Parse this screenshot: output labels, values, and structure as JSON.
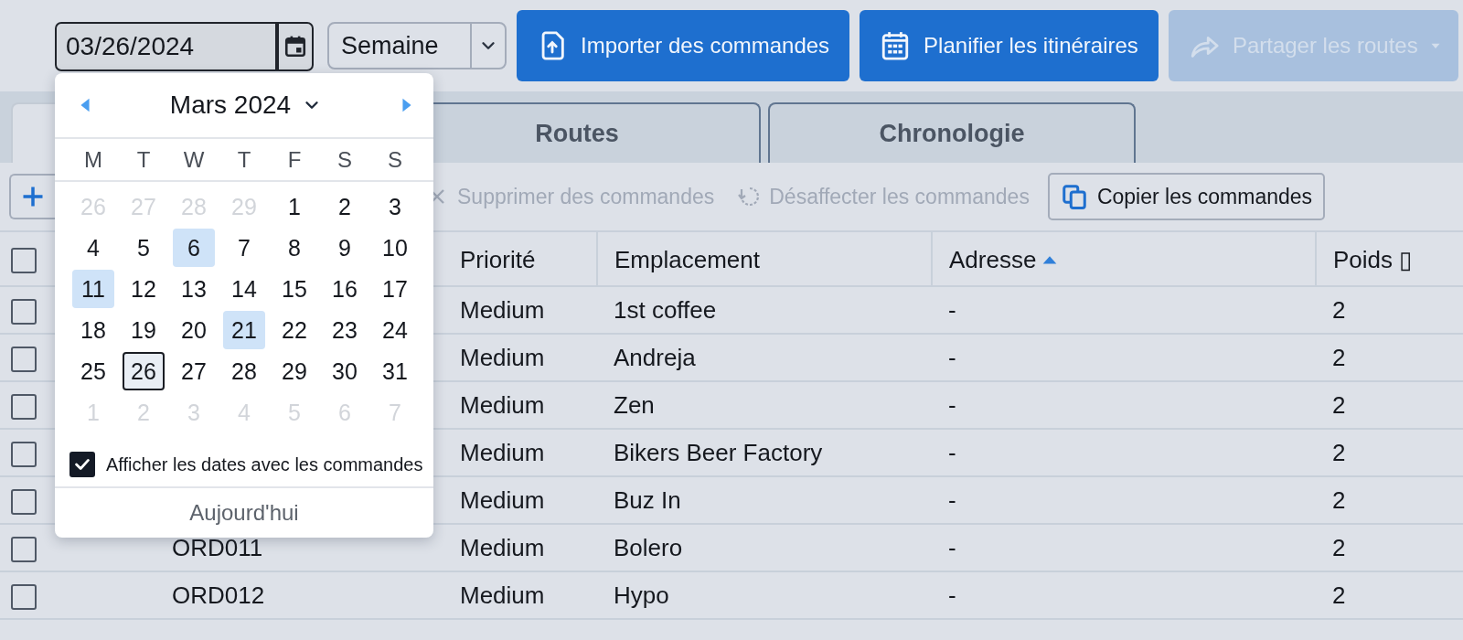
{
  "toolbar": {
    "date_field": {
      "value": "03/26/2024"
    },
    "period_select": {
      "value": "Semaine"
    },
    "buttons": [
      {
        "label": "Importer des commandes",
        "kind": "import",
        "disabled": false,
        "dropdown": false
      },
      {
        "label": "Planifier les itinéraires",
        "kind": "plan",
        "disabled": false,
        "dropdown": false
      },
      {
        "label": "Partager les routes",
        "kind": "share",
        "disabled": true,
        "dropdown": true
      }
    ]
  },
  "tabs": [
    {
      "selected": true
    },
    {
      "label": "Routes",
      "selected": false
    },
    {
      "label": "Chronologie",
      "selected": false
    }
  ],
  "actions": [
    {
      "kind": "add"
    },
    {
      "label": "Supprimer des commandes",
      "kind": "delete",
      "disabled": true
    },
    {
      "label": "Désaffecter les commandes",
      "kind": "unassign",
      "disabled": true
    },
    {
      "label": "Copier les commandes",
      "kind": "copy",
      "disabled": false
    }
  ],
  "table": {
    "header_checked": false,
    "columns": [
      {
        "label": "Priorité",
        "sorted": false
      },
      {
        "label": "Emplacement",
        "sorted": false
      },
      {
        "label": "Adresse",
        "sorted": true
      },
      {
        "label": "Poids ▯",
        "sorted": false
      }
    ],
    "rows": [
      {
        "checked": false,
        "priority": "Medium",
        "location": "1st coffee",
        "address": "-",
        "weight": "2"
      },
      {
        "checked": false,
        "priority": "Medium",
        "location": "Andreja",
        "address": "-",
        "weight": "2"
      },
      {
        "checked": false,
        "priority": "Medium",
        "location": "Zen",
        "address": "-",
        "weight": "2"
      },
      {
        "checked": false,
        "priority": "Medium",
        "location": "Bikers Beer Factory",
        "address": "-",
        "weight": "2"
      },
      {
        "checked": false,
        "priority": "Medium",
        "location": "Buz In",
        "address": "-",
        "weight": "2"
      },
      {
        "checked": false,
        "order": "ORD011",
        "priority": "Medium",
        "location": "Bolero",
        "address": "-",
        "weight": "2"
      },
      {
        "checked": false,
        "order": "ORD012",
        "priority": "Medium",
        "location": "Hypo",
        "address": "-",
        "weight": "2"
      }
    ]
  },
  "calendar": {
    "month": "Mars 2024",
    "weekdays": [
      "M",
      "T",
      "W",
      "T",
      "F",
      "S",
      "S"
    ],
    "weeks": [
      [
        {
          "day": "26",
          "outside": true,
          "marked": false,
          "selected": false
        },
        {
          "day": "27",
          "outside": true,
          "marked": false,
          "selected": false
        },
        {
          "day": "28",
          "outside": true,
          "marked": false,
          "selected": false
        },
        {
          "day": "29",
          "outside": true,
          "marked": false,
          "selected": false
        },
        {
          "day": "1",
          "outside": false,
          "marked": false,
          "selected": false
        },
        {
          "day": "2",
          "outside": false,
          "marked": false,
          "selected": false
        },
        {
          "day": "3",
          "outside": false,
          "marked": false,
          "selected": false
        }
      ],
      [
        {
          "day": "4",
          "outside": false,
          "marked": false,
          "selected": false
        },
        {
          "day": "5",
          "outside": false,
          "marked": false,
          "selected": false
        },
        {
          "day": "6",
          "outside": false,
          "marked": true,
          "selected": false
        },
        {
          "day": "7",
          "outside": false,
          "marked": false,
          "selected": false
        },
        {
          "day": "8",
          "outside": false,
          "marked": false,
          "selected": false
        },
        {
          "day": "9",
          "outside": false,
          "marked": false,
          "selected": false
        },
        {
          "day": "10",
          "outside": false,
          "marked": false,
          "selected": false
        }
      ],
      [
        {
          "day": "11",
          "outside": false,
          "marked": true,
          "selected": false
        },
        {
          "day": "12",
          "outside": false,
          "marked": false,
          "selected": false
        },
        {
          "day": "13",
          "outside": false,
          "marked": false,
          "selected": false
        },
        {
          "day": "14",
          "outside": false,
          "marked": false,
          "selected": false
        },
        {
          "day": "15",
          "outside": false,
          "marked": false,
          "selected": false
        },
        {
          "day": "16",
          "outside": false,
          "marked": false,
          "selected": false
        },
        {
          "day": "17",
          "outside": false,
          "marked": false,
          "selected": false
        }
      ],
      [
        {
          "day": "18",
          "outside": false,
          "marked": false,
          "selected": false
        },
        {
          "day": "19",
          "outside": false,
          "marked": false,
          "selected": false
        },
        {
          "day": "20",
          "outside": false,
          "marked": false,
          "selected": false
        },
        {
          "day": "21",
          "outside": false,
          "marked": true,
          "selected": false
        },
        {
          "day": "22",
          "outside": false,
          "marked": false,
          "selected": false
        },
        {
          "day": "23",
          "outside": false,
          "marked": false,
          "selected": false
        },
        {
          "day": "24",
          "outside": false,
          "marked": false,
          "selected": false
        }
      ],
      [
        {
          "day": "25",
          "outside": false,
          "marked": false,
          "selected": false
        },
        {
          "day": "26",
          "outside": false,
          "marked": false,
          "selected": true
        },
        {
          "day": "27",
          "outside": false,
          "marked": false,
          "selected": false
        },
        {
          "day": "28",
          "outside": false,
          "marked": false,
          "selected": false
        },
        {
          "day": "29",
          "outside": false,
          "marked": false,
          "selected": false
        },
        {
          "day": "30",
          "outside": false,
          "marked": false,
          "selected": false
        },
        {
          "day": "31",
          "outside": false,
          "marked": false,
          "selected": false
        }
      ],
      [
        {
          "day": "1",
          "outside": true,
          "marked": false,
          "selected": false
        },
        {
          "day": "2",
          "outside": true,
          "marked": false,
          "selected": false
        },
        {
          "day": "3",
          "outside": true,
          "marked": false,
          "selected": false
        },
        {
          "day": "4",
          "outside": true,
          "marked": false,
          "selected": false
        },
        {
          "day": "5",
          "outside": true,
          "marked": false,
          "selected": false
        },
        {
          "day": "6",
          "outside": true,
          "marked": false,
          "selected": false
        },
        {
          "day": "7",
          "outside": true,
          "marked": false,
          "selected": false
        }
      ]
    ],
    "show_order_dates": {
      "label": "Afficher les dates avec les commandes",
      "checked": true
    },
    "today": "Aujourd'hui"
  }
}
